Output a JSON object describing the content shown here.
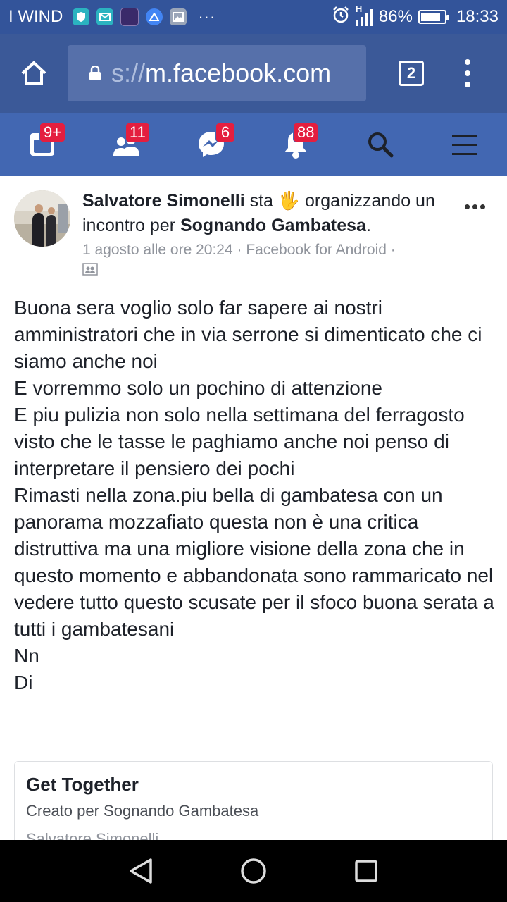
{
  "status_bar": {
    "carrier": "I WIND",
    "more_indicator": "···",
    "battery_percent": "86%",
    "battery_level": 0.86,
    "time": "18:33",
    "network_letter": "H"
  },
  "browser": {
    "url_prefix": "s://",
    "url_domain": "m.facebook.com",
    "tab_count": "2"
  },
  "fb_nav": {
    "news_badge": "9+",
    "friends_badge": "11",
    "messages_badge": "6",
    "notifications_badge": "88"
  },
  "post": {
    "author": "Salvatore Simonelli",
    "activity_pre": "sta",
    "activity_emoji": "🖐",
    "activity_text": "organizzando un incontro per",
    "group": "Sognando Gambatesa",
    "activity_end": ".",
    "timestamp": "1 agosto alle ore 20:24 · Facebook for Android ·",
    "body_lines": [
      "Buona sera voglio solo far sapere ai nostri amministratori che in via serrone si dimenticato che ci siamo anche noi",
      "E vorremmo solo un pochino di attenzione",
      "E piu pulizia non solo nella settimana del ferragosto visto che le tasse le paghiamo anche noi penso di interpretare il pensiero dei pochi",
      "Rimasti nella zona.piu bella di gambatesa con un panorama mozzafiato questa non è una critica distruttiva ma una migliore visione della zona che in questo momento e abbandonata sono rammaricato nel vedere tutto questo scusate per il sfoco buona serata a tutti i gambatesani",
      "Nn",
      "Di"
    ],
    "event": {
      "title": "Get Together",
      "subtitle": "Creato per Sognando Gambatesa",
      "by": "Salvatore Simonelli"
    }
  },
  "colors": {
    "status_bar": "#33549a",
    "browser_bar": "#3b5998",
    "fb_nav": "#4267b2",
    "badge": "#e41e3f"
  }
}
